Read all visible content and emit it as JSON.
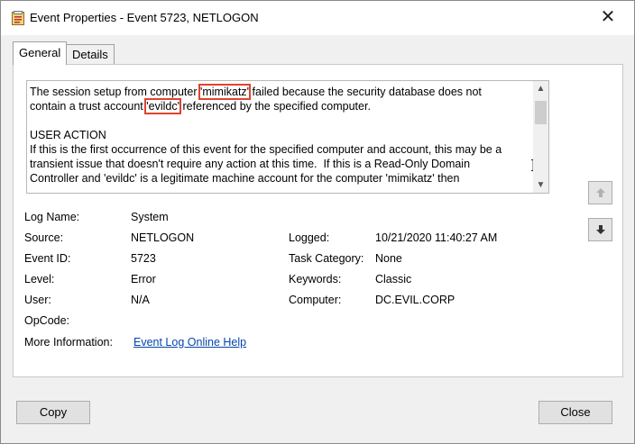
{
  "window": {
    "title": "Event Properties - Event 5723, NETLOGON",
    "close_glyph": "✕"
  },
  "tabs": [
    {
      "label": "General",
      "active": true
    },
    {
      "label": "Details",
      "active": false
    }
  ],
  "description": {
    "line1_pre": "The session setup from computer ",
    "line1_hl": "'mimikatz'",
    "line1_post": " failed because the security database does not",
    "line2_pre": "contain a trust account ",
    "line2_hl": "'evildc'",
    "line2_post": " referenced by the specified computer.",
    "rest": "\nUSER ACTION\nIf this is the first occurrence of this event for the specified computer and account, this may be a\ntransient issue that doesn't require any action at this time.  If this is a Read-Only Domain\nController and 'evildc' is a legitimate machine account for the computer 'mimikatz' then",
    "highlight_color": "#e0432f"
  },
  "details": {
    "log_name": {
      "label": "Log Name:",
      "value": "System"
    },
    "source": {
      "label": "Source:",
      "value": "NETLOGON"
    },
    "logged": {
      "label": "Logged:",
      "value": "10/21/2020 11:40:27 AM"
    },
    "event_id": {
      "label": "Event ID:",
      "value": "5723"
    },
    "task_category": {
      "label": "Task Category:",
      "value": "None"
    },
    "level": {
      "label": "Level:",
      "value": "Error"
    },
    "keywords": {
      "label": "Keywords:",
      "value": "Classic"
    },
    "user": {
      "label": "User:",
      "value": "N/A"
    },
    "computer": {
      "label": "Computer:",
      "value": "DC.EVIL.CORP"
    },
    "opcode": {
      "label": "OpCode:",
      "value": ""
    },
    "more_info": {
      "label": "More Information:",
      "link": "Event Log Online Help"
    }
  },
  "side_buttons": {
    "up_icon": "up-arrow-icon",
    "down_icon": "down-arrow-icon"
  },
  "buttons": {
    "copy": "Copy",
    "close": "Close"
  }
}
